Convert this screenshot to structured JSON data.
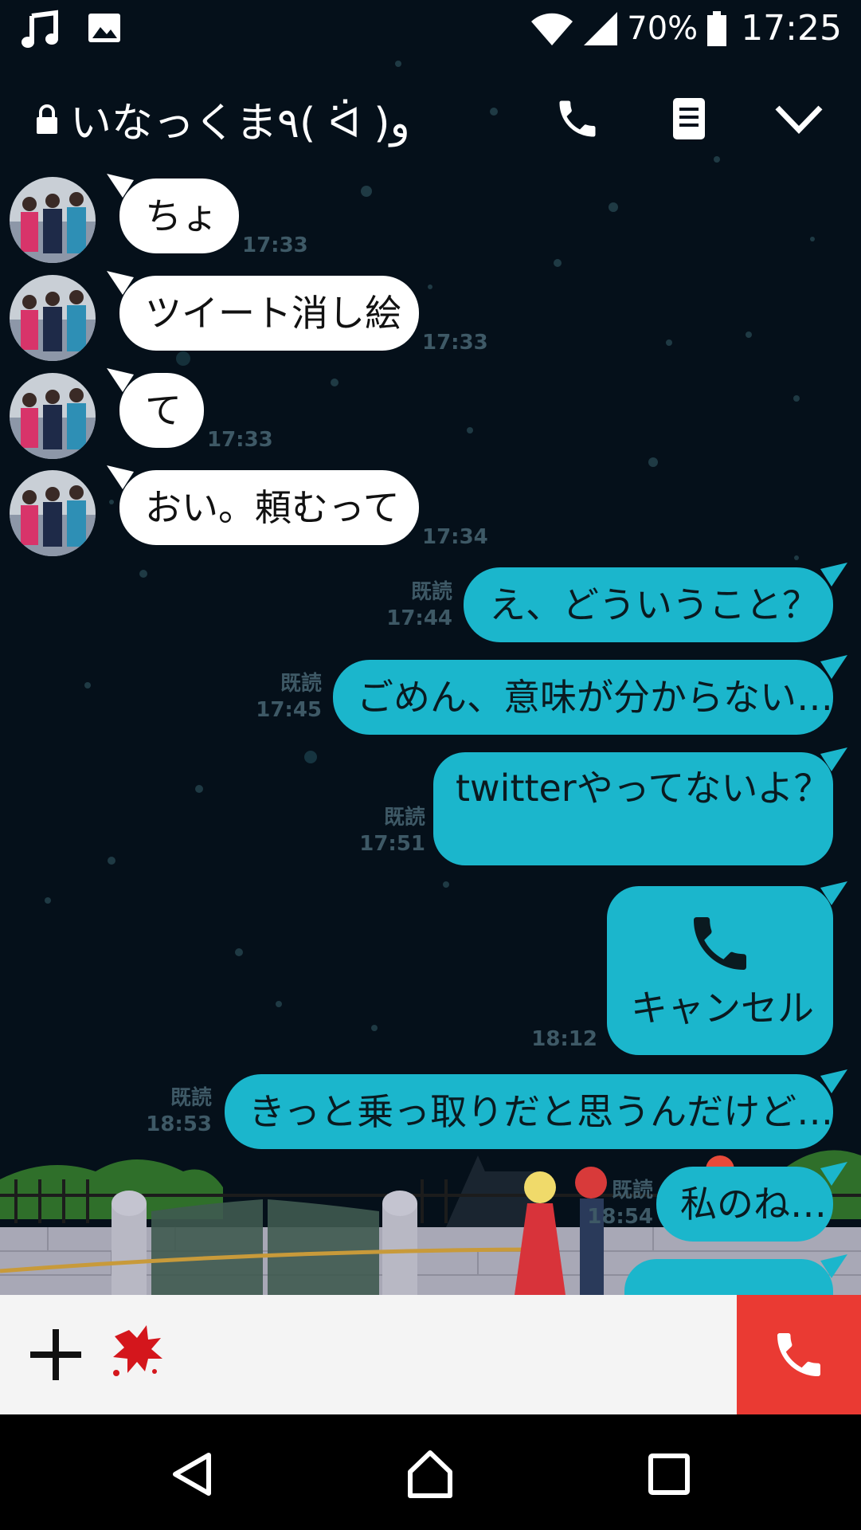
{
  "status_bar": {
    "battery": "70%",
    "time": "17:25",
    "icons": [
      "music-icon",
      "gallery-icon",
      "wifi-icon",
      "signal-icon",
      "battery-icon"
    ]
  },
  "header": {
    "title": "いなっくま٩( ᐛ )و",
    "icons": [
      "lock-icon",
      "phone-icon",
      "notes-icon",
      "chevron-down-icon"
    ]
  },
  "messages": [
    {
      "side": "in",
      "text": "ちょ",
      "time": "17:33"
    },
    {
      "side": "in",
      "text": "ツイート消し絵",
      "time": "17:33"
    },
    {
      "side": "in",
      "text": "て",
      "time": "17:33"
    },
    {
      "side": "in",
      "text": "おい。頼むって",
      "time": "17:34"
    },
    {
      "side": "out",
      "text": "え、どういうこと？",
      "read": "既読",
      "time": "17:44"
    },
    {
      "side": "out",
      "text": "ごめん、意味が分からない…",
      "read": "既読",
      "time": "17:45"
    },
    {
      "side": "out",
      "text": "twitterやってないよ？",
      "read": "既読",
      "time": "17:51"
    },
    {
      "side": "out",
      "type": "call",
      "text": "キャンセル",
      "time": "18:12"
    },
    {
      "side": "out",
      "text": "きっと乗っ取りだと思うんだけど…",
      "read": "既読",
      "time": "18:53"
    },
    {
      "side": "out",
      "text": "私のね…",
      "read": "既読",
      "time": "18:54"
    }
  ],
  "colors": {
    "background": "#05101a",
    "incoming_bubble": "#ffffff",
    "outgoing_bubble": "#1bb6cc",
    "call_button": "#ea3a33",
    "input_bar": "#f4f4f4"
  },
  "input_bar": {
    "icons": [
      "plus-icon",
      "sticker-icon",
      "phone-icon"
    ]
  },
  "nav_bar": {
    "icons": [
      "back-icon",
      "home-icon",
      "recents-icon"
    ]
  }
}
